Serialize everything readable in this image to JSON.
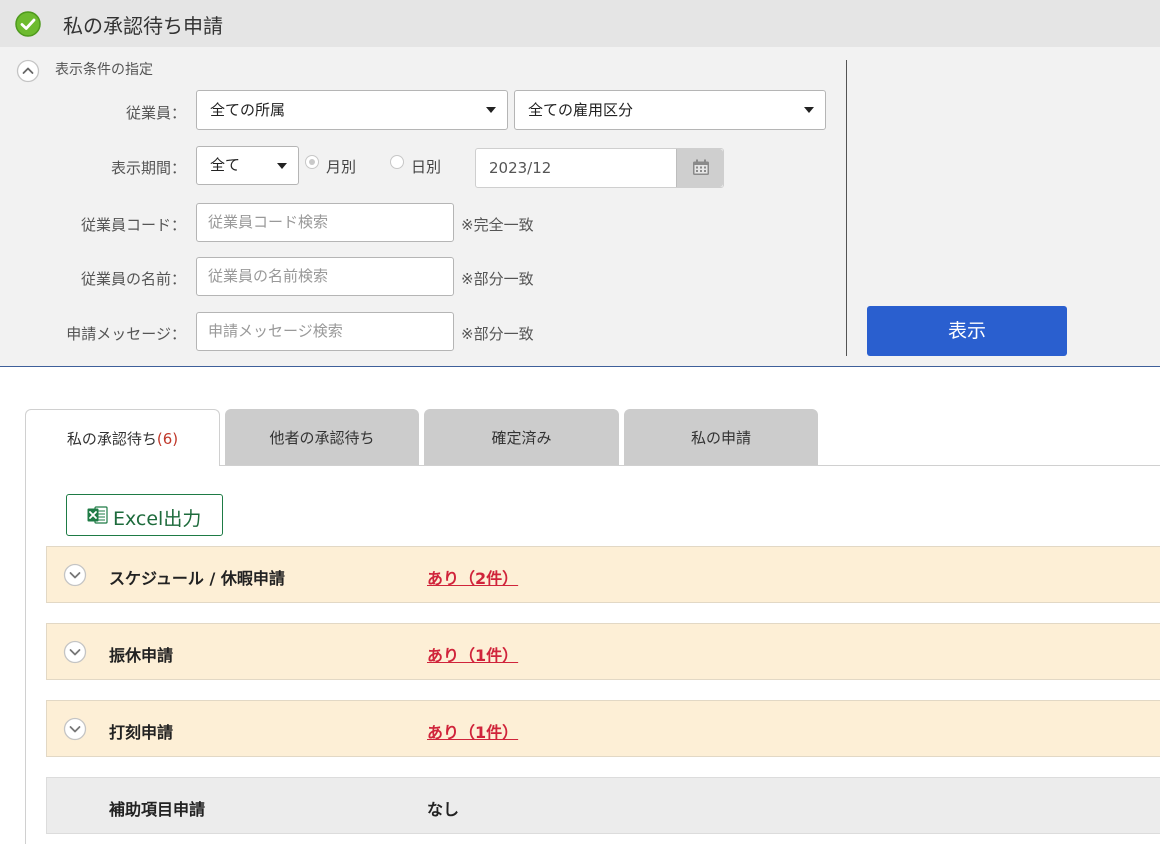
{
  "header": {
    "title": "私の承認待ち申請",
    "check_icon": "check-circle-icon"
  },
  "conditions": {
    "section_title": "表示条件の指定",
    "employee_label": "従業員：",
    "affiliation_select": "全ての所属",
    "employment_select": "全ての雇用区分",
    "period_label": "表示期間：",
    "period_select": "全て",
    "radio_monthly": "月別",
    "radio_daily": "日別",
    "date_value": "2023/12",
    "code_label": "従業員コード：",
    "code_placeholder": "従業員コード検索",
    "code_note": "※完全一致",
    "name_label": "従業員の名前：",
    "name_placeholder": "従業員の名前検索",
    "name_note": "※部分一致",
    "message_label": "申請メッセージ：",
    "message_placeholder": "申請メッセージ検索",
    "message_note": "※部分一致",
    "show_button": "表示"
  },
  "tabs": [
    {
      "label": "私の承認待ち",
      "count": "(6)",
      "active": true
    },
    {
      "label": "他者の承認待ち",
      "active": false
    },
    {
      "label": "確定済み",
      "active": false
    },
    {
      "label": "私の申請",
      "active": false
    }
  ],
  "excel_button": "Excel出力",
  "requests": [
    {
      "name": "スケジュール / 休暇申請",
      "status": "あり（2件）",
      "has_items": true
    },
    {
      "name": "振休申請",
      "status": "あり（1件）",
      "has_items": true
    },
    {
      "name": "打刻申請",
      "status": "あり（1件）",
      "has_items": true
    },
    {
      "name": "補助項目申請",
      "status": "なし",
      "has_items": false
    }
  ],
  "colors": {
    "accent_blue": "#2a5fcf",
    "link_red": "#d0243b",
    "excel_green": "#1e7b45",
    "row_highlight": "#fdefd6"
  }
}
